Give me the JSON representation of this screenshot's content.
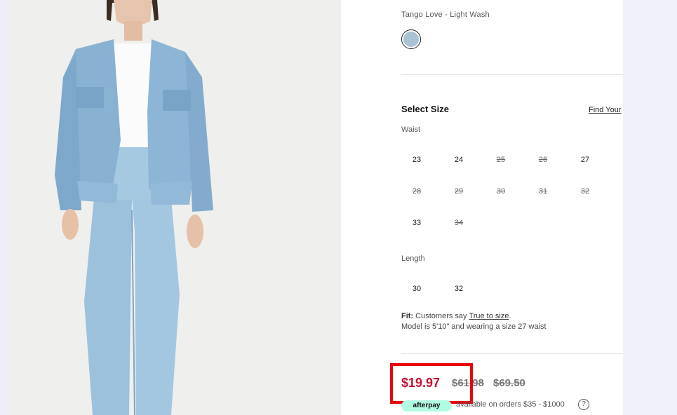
{
  "product": {
    "color_name": "Tango Love - Light Wash",
    "swatch_color": "#a9c3d4"
  },
  "size": {
    "title": "Select Size",
    "find_link": "Find Your",
    "waist_label": "Waist",
    "waist": [
      {
        "label": "23",
        "available": true
      },
      {
        "label": "24",
        "available": true
      },
      {
        "label": "25",
        "available": false
      },
      {
        "label": "26",
        "available": false
      },
      {
        "label": "27",
        "available": true
      },
      {
        "label": "28",
        "available": false
      },
      {
        "label": "29",
        "available": false
      },
      {
        "label": "30",
        "available": false
      },
      {
        "label": "31",
        "available": false
      },
      {
        "label": "32",
        "available": false
      },
      {
        "label": "33",
        "available": true
      },
      {
        "label": "34",
        "available": false
      }
    ],
    "length_label": "Length",
    "length": [
      {
        "label": "30",
        "available": true
      },
      {
        "label": "32",
        "available": true
      }
    ]
  },
  "fit": {
    "prefix": "Fit:",
    "text": "Customers say",
    "link": "True to size",
    "suffix": ".",
    "model": "Model is 5'10\" and wearing a size 27 waist"
  },
  "price": {
    "sale": "$19.97",
    "was": "$61.98",
    "original": "$69.50",
    "sale_color": "#c41230"
  },
  "afterpay": {
    "badge": "afterpay",
    "text": "available on orders $35 - $1000",
    "help": "?"
  },
  "colors": {
    "highlight": "#e8000f",
    "afterpay_mint": "#b2fce4"
  }
}
